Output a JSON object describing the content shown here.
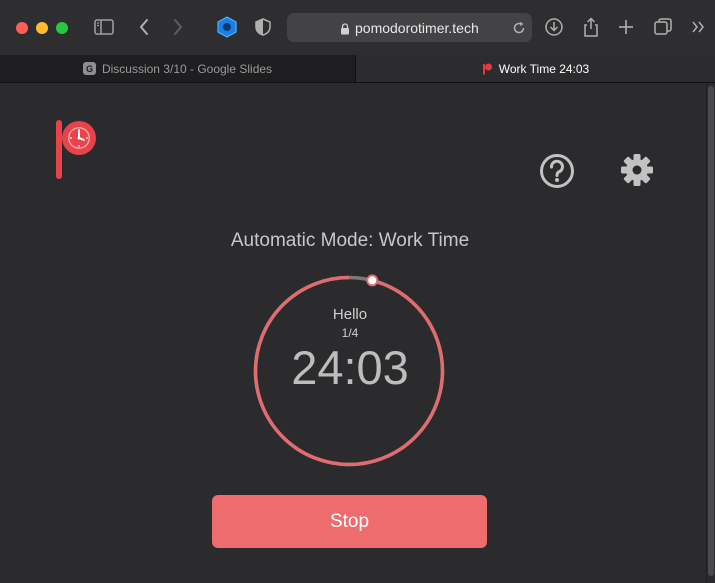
{
  "browser": {
    "address": "pomodorotimer.tech",
    "tabs": [
      {
        "label": "Discussion 3/10 - Google Slides",
        "favicon": "G",
        "active": false
      },
      {
        "label": "Work Time 24:03",
        "active": true
      }
    ]
  },
  "app": {
    "mode_label": "Automatic Mode: Work Time",
    "task_name": "Hello",
    "session_count": "1/4",
    "timer": "24:03",
    "progress_fraction_remaining": 0.96,
    "stop_label": "Stop"
  },
  "colors": {
    "accent": "#ee6b6e",
    "ring": "#e06c6f",
    "background": "#2b2b2d"
  },
  "icons": [
    "logo-icon",
    "help-icon",
    "settings-icon",
    "sidebar-icon",
    "back-icon",
    "forward-icon",
    "shield-icon",
    "privacy-icon",
    "lock-icon",
    "reload-icon",
    "download-icon",
    "share-icon",
    "new-tab-icon",
    "tab-overview-icon",
    "more-icon"
  ]
}
